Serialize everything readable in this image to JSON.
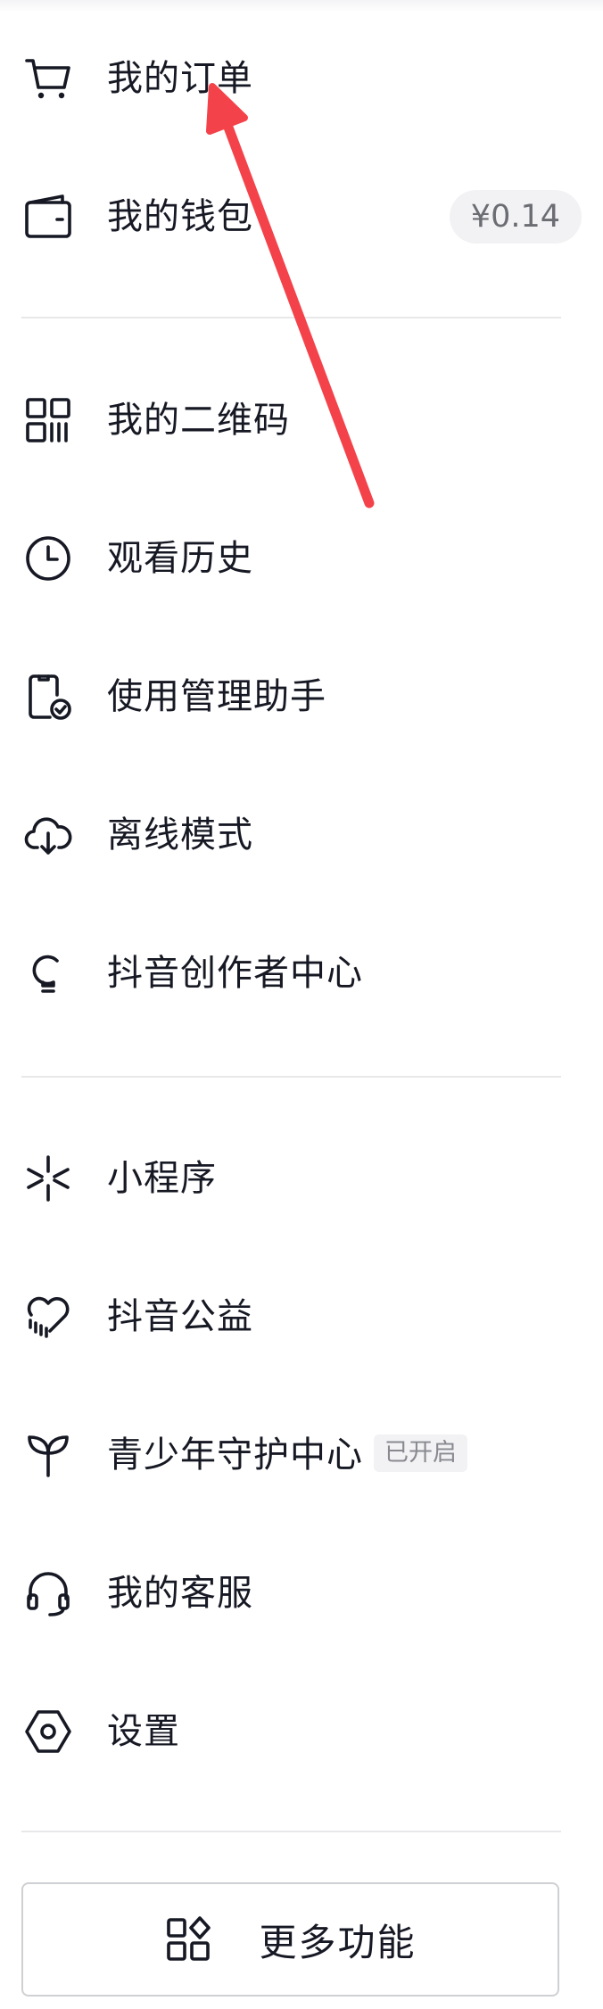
{
  "menu": {
    "orders": {
      "label": "我的订单",
      "icon": "cart-icon"
    },
    "wallet": {
      "label": "我的钱包",
      "icon": "wallet-icon",
      "balance": "¥0.14"
    },
    "qrcode": {
      "label": "我的二维码",
      "icon": "qr-code-icon"
    },
    "history": {
      "label": "观看历史",
      "icon": "clock-icon"
    },
    "usage": {
      "label": "使用管理助手",
      "icon": "phone-check-icon"
    },
    "offline": {
      "label": "离线模式",
      "icon": "cloud-download-icon"
    },
    "creator": {
      "label": "抖音创作者中心",
      "icon": "lightbulb-icon"
    },
    "miniapps": {
      "label": "小程序",
      "icon": "asterisk-icon"
    },
    "charity": {
      "label": "抖音公益",
      "icon": "heart-rain-icon"
    },
    "youth": {
      "label": "青少年守护中心",
      "icon": "sprout-icon",
      "status": "已开启"
    },
    "service": {
      "label": "我的客服",
      "icon": "headset-icon"
    },
    "settings": {
      "label": "设置",
      "icon": "hexagon-gear-icon"
    }
  },
  "more_button": {
    "label": "更多功能",
    "icon": "grid-shapes-icon"
  },
  "colors": {
    "text": "#161823",
    "divider": "#e8e8ea",
    "badge_bg": "#f2f2f4",
    "annotation_arrow": "#f4424a"
  }
}
